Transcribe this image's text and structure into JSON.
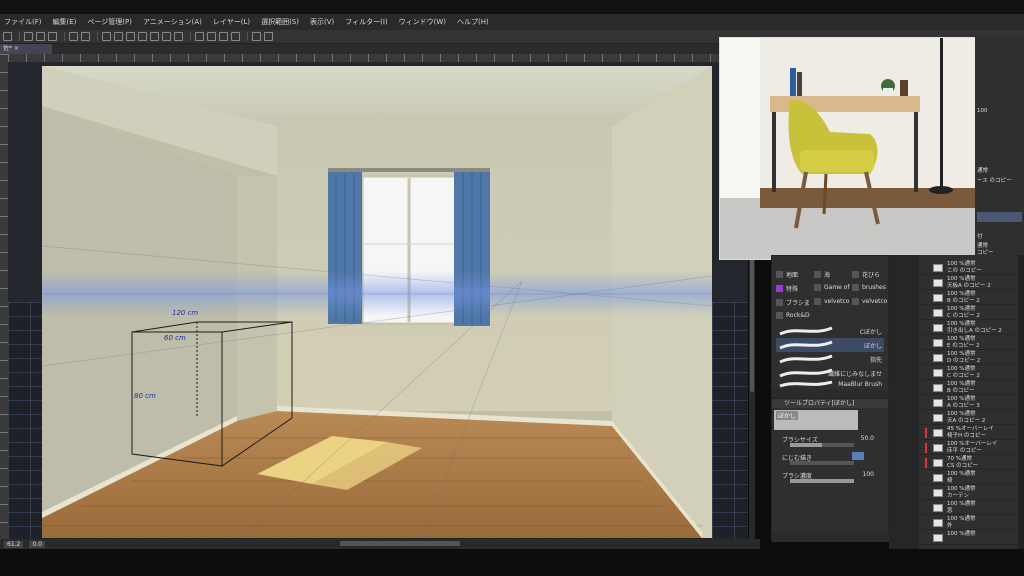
{
  "menu": [
    "ファイル(F)",
    "編集(E)",
    "ページ管理(P)",
    "アニメーション(A)",
    "レイヤー(L)",
    "選択範囲(S)",
    "表示(V)",
    "フィルター(I)",
    "ウィンドウ(W)",
    "ヘルプ(H)"
  ],
  "canvas": {
    "tab_label": "佐*",
    "annotations": {
      "width": "120 cm",
      "depth": "60 cm",
      "height": "80 cm"
    }
  },
  "status": {
    "zoom": "61.2",
    "angle": "0.0"
  },
  "brushes": {
    "groups": [
      {
        "label": "地面",
        "icon": "brush-icon"
      },
      {
        "label": "海",
        "icon": "brush-icon"
      },
      {
        "label": "花びら",
        "icon": "brush-icon"
      },
      {
        "label": "特殊",
        "icon": "plus-icon",
        "accent": "#9b38d8"
      },
      {
        "label": "Game of",
        "icon": "brush-icon"
      },
      {
        "label": "brushes",
        "icon": "brush-icon"
      },
      {
        "label": "ブラシま",
        "icon": "brush-icon"
      },
      {
        "label": "velvetco",
        "icon": "brush-icon"
      },
      {
        "label": "velvetco",
        "icon": "brush-icon"
      },
      {
        "label": "Rock&D",
        "icon": "brush-icon"
      }
    ],
    "items": [
      {
        "label": "Cぼかし",
        "selected": false
      },
      {
        "label": "ぼかし",
        "selected": true
      },
      {
        "label": "指先",
        "selected": false
      },
      {
        "label": "繊維にじみなしませ",
        "selected": false
      },
      {
        "label": "MaaBlur Brush",
        "selected": false
      }
    ]
  },
  "tool_property": {
    "title": "ツールプロパティ[ぼかし]",
    "preview_label": "ぼかし",
    "brush_size_label": "ブラシサイズ",
    "brush_size_value": "50.0",
    "brush_size_fraction": 0.5,
    "blend_label": "にじむ描き",
    "density_label": "ブラシ濃度",
    "density_value": "100",
    "density_fraction": 1.0
  },
  "layers": [
    {
      "line1": "100 %通常",
      "line2": "この のコピー",
      "red": false
    },
    {
      "line1": "100 %通常",
      "line2": "天板A のコピー 2",
      "red": false
    },
    {
      "line1": "100 %通常",
      "line2": "B のコピー 2",
      "red": false
    },
    {
      "line1": "100 %通常",
      "line2": "C のコピー 2",
      "red": false
    },
    {
      "line1": "100 %通常",
      "line2": "引き出しA のコピー 2",
      "red": false
    },
    {
      "line1": "100 %通常",
      "line2": "E のコピー 2",
      "red": false
    },
    {
      "line1": "100 %通常",
      "line2": "D のコピー 2",
      "red": false
    },
    {
      "line1": "100 %通常",
      "line2": "C のコピー 2",
      "red": false
    },
    {
      "line1": "100 %通常",
      "line2": "B のコピー",
      "red": false
    },
    {
      "line1": "100 %通常",
      "line2": "A のコピー 3",
      "red": false
    },
    {
      "line1": "100 %通常",
      "line2": "天A のコピー 2",
      "red": false
    },
    {
      "line1": "45 %オーバーレイ",
      "line2": "椅子H のコピー",
      "red": true
    },
    {
      "line1": "100 %オーバーレイ",
      "line2": "床平 のコピー",
      "red": true
    },
    {
      "line1": "70 %通常",
      "line2": "CS のコピー",
      "red": true
    },
    {
      "line1": "100 %通常",
      "line2": "椅",
      "red": false
    },
    {
      "line1": "100 %通常",
      "line2": "カーテン",
      "red": false
    },
    {
      "line1": "100 %通常",
      "line2": "窓",
      "red": false
    },
    {
      "line1": "100 %通常",
      "line2": "外",
      "red": false
    },
    {
      "line1": "100 %通常",
      "line2": "",
      "red": false
    }
  ],
  "layers_top": [
    {
      "text": "100",
      "selected": false
    },
    {
      "text": "通常",
      "selected": false
    },
    {
      "text": "ース のコピー",
      "selected": false
    },
    {
      "text": "",
      "selected": true
    },
    {
      "text": "付",
      "selected": false
    },
    {
      "text": "通常",
      "selected": false
    },
    {
      "text": "コピー",
      "selected": false
    }
  ]
}
